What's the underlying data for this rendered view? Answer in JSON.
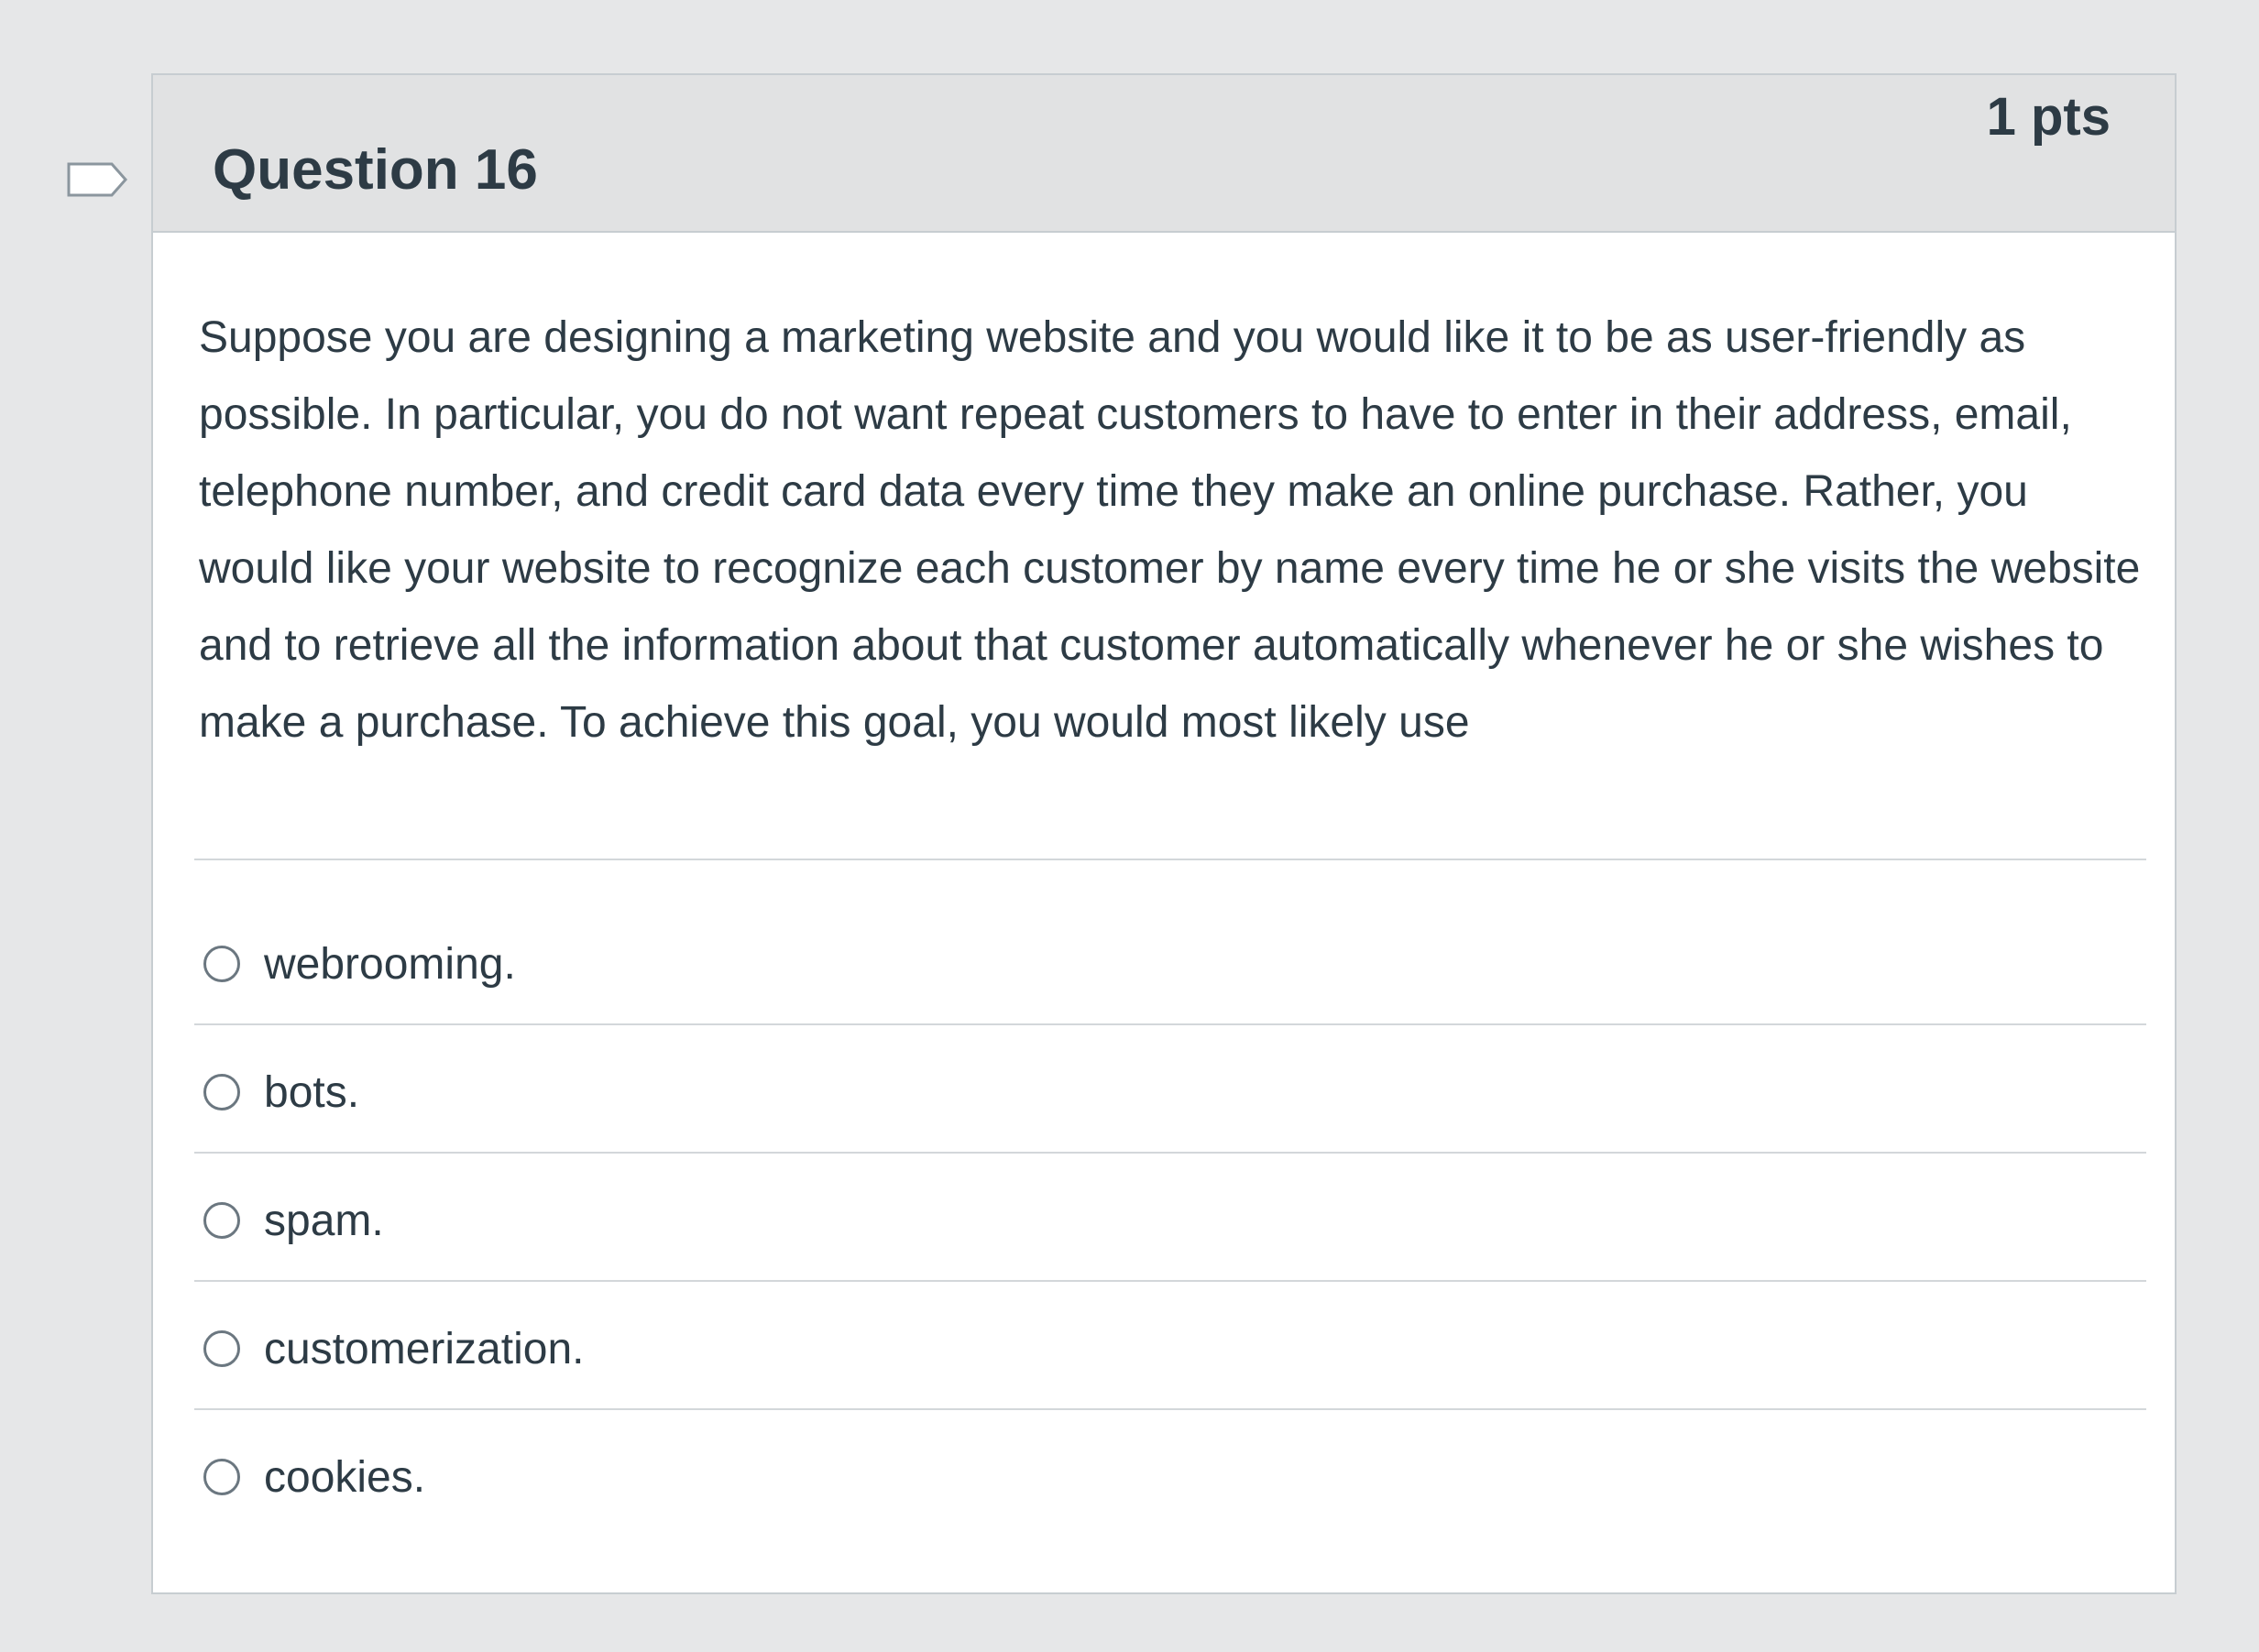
{
  "question": {
    "title": "Question 16",
    "points": "1 pts",
    "text": "Suppose you are designing a marketing website and you would like it to be as user-friendly as possible. In particular, you do not want repeat customers to have to enter in their address, email, telephone number, and credit card data every time they make an online purchase. Rather, you would like your website to recognize each customer by name every time he or she visits the website and to retrieve all the information about that customer automatically whenever he or she wishes to make a purchase. To achieve this goal, you would most likely use"
  },
  "answers": [
    {
      "label": "webrooming."
    },
    {
      "label": "bots."
    },
    {
      "label": "spam."
    },
    {
      "label": "customerization."
    },
    {
      "label": "cookies."
    }
  ],
  "icons": {
    "flag": "flag-icon",
    "radio": "radio-button-icon"
  },
  "colors": {
    "header_bg": "#e1e2e3",
    "text": "#2d3b45",
    "border": "#c7cdd1"
  }
}
